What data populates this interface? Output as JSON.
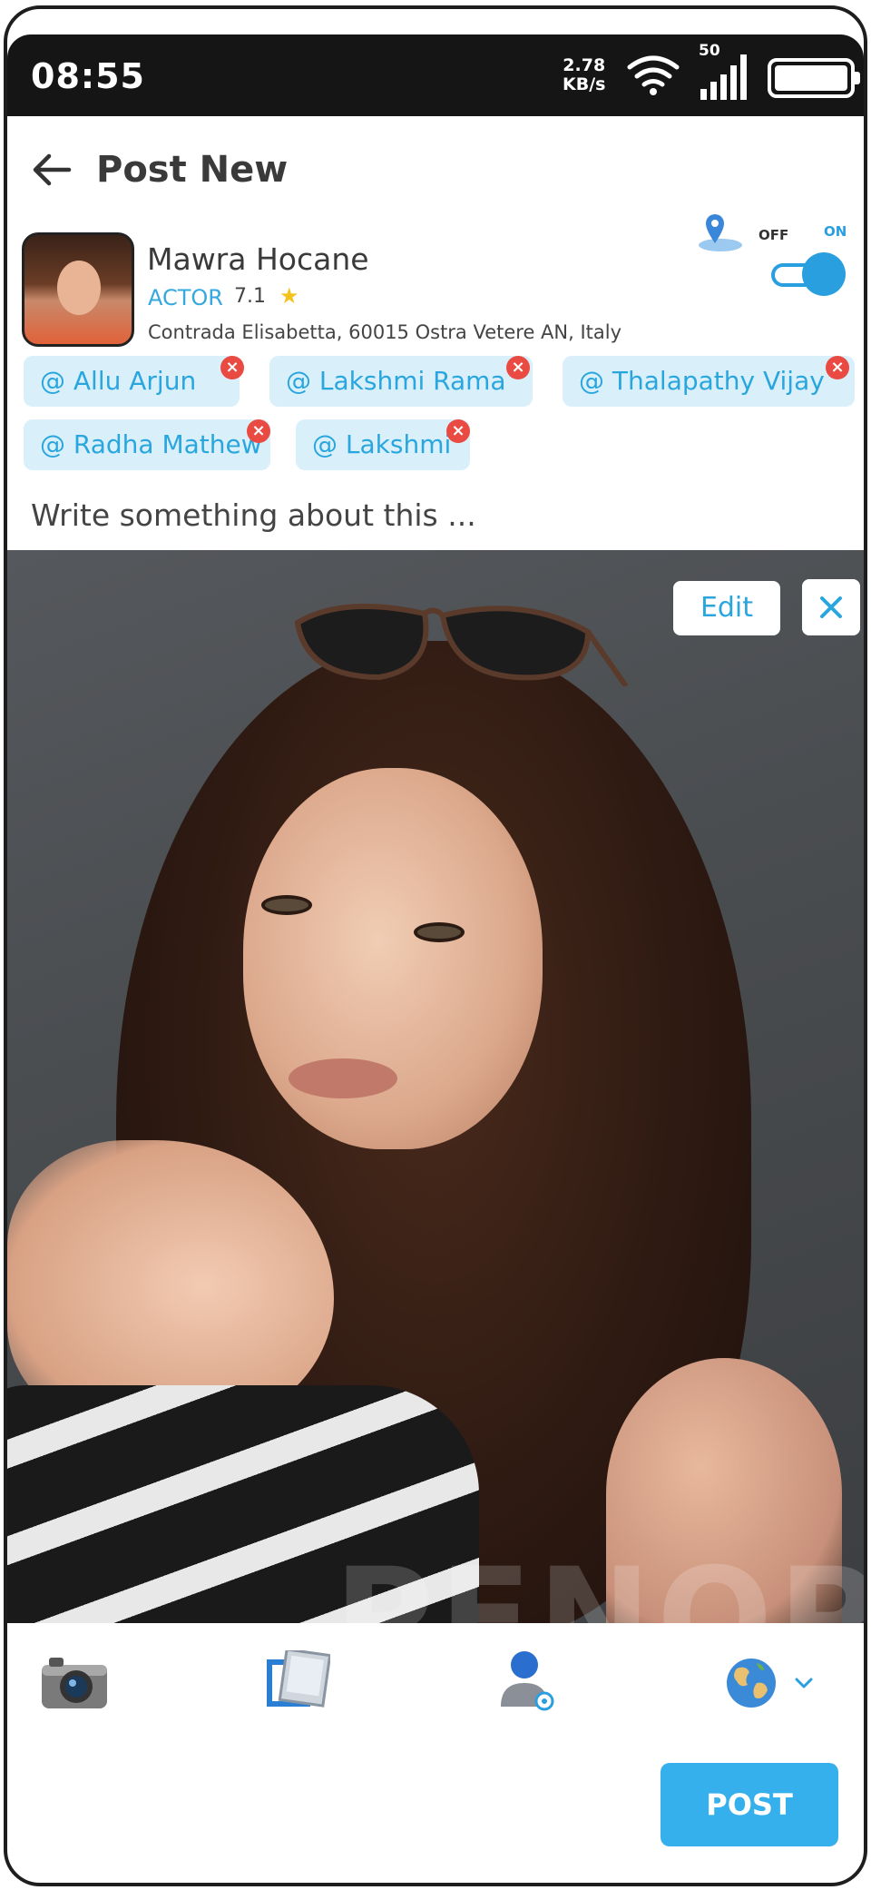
{
  "status_bar": {
    "time": "08:55",
    "speed_value": "2.78",
    "speed_unit": "KB/s",
    "network": "50"
  },
  "header": {
    "title": "Post New"
  },
  "profile": {
    "name": "Mawra Hocane",
    "role": "ACTOR",
    "rating": "7.1",
    "location": "Contrada Elisabetta, 60015 Ostra Vetere AN, Italy"
  },
  "location_toggle": {
    "off_label": "OFF",
    "on_label": "ON",
    "state": "on"
  },
  "tags": [
    {
      "label": "@ Allu Arjun"
    },
    {
      "label": "@ Lakshmi Rama"
    },
    {
      "label": "@ Thalapathy Vijay"
    },
    {
      "label": "@ Radha Mathew"
    },
    {
      "label": "@ Lakshmi"
    }
  ],
  "caption": {
    "placeholder": "Write something about this ..."
  },
  "photo": {
    "edit_label": "Edit",
    "watermark": "PENOP"
  },
  "toolbar": {
    "icons": [
      "camera-icon",
      "gallery-icon",
      "tag-people-icon",
      "globe-icon",
      "chevron-down-icon"
    ],
    "post_label": "POST"
  },
  "colors": {
    "accent": "#2a9fe0",
    "tag_bg": "#d9f0fb",
    "remove": "#e94a41",
    "post_button": "#36b0ec"
  }
}
